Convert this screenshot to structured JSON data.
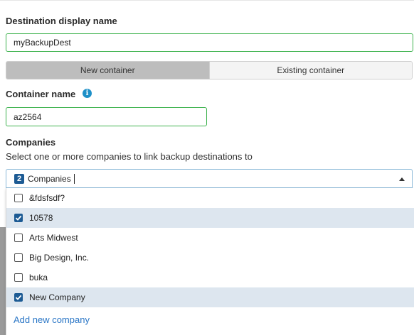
{
  "form": {
    "destination_label": "Destination display name",
    "destination_value": "myBackupDest",
    "container_tabs": [
      "New container",
      "Existing container"
    ],
    "active_tab": "New container",
    "container_name_label": "Container name",
    "container_name_value": "az2564",
    "info_icon_glyph": "i",
    "companies_label": "Companies",
    "companies_helper": "Select one or more companies to link backup destinations to"
  },
  "companies_select": {
    "selected_count": "2",
    "selected_text": "Companies",
    "options": [
      {
        "label": "&fdsfsdf?",
        "checked": false
      },
      {
        "label": "10578",
        "checked": true
      },
      {
        "label": "Arts Midwest",
        "checked": false
      },
      {
        "label": "Big Design, Inc.",
        "checked": false
      },
      {
        "label": "buka",
        "checked": false
      },
      {
        "label": "New Company",
        "checked": true
      }
    ],
    "add_link": "Add new company"
  },
  "colors": {
    "valid_border": "#3fb34f",
    "accent": "#1d5b94",
    "link": "#2a76c6",
    "info": "#1e90c8"
  }
}
